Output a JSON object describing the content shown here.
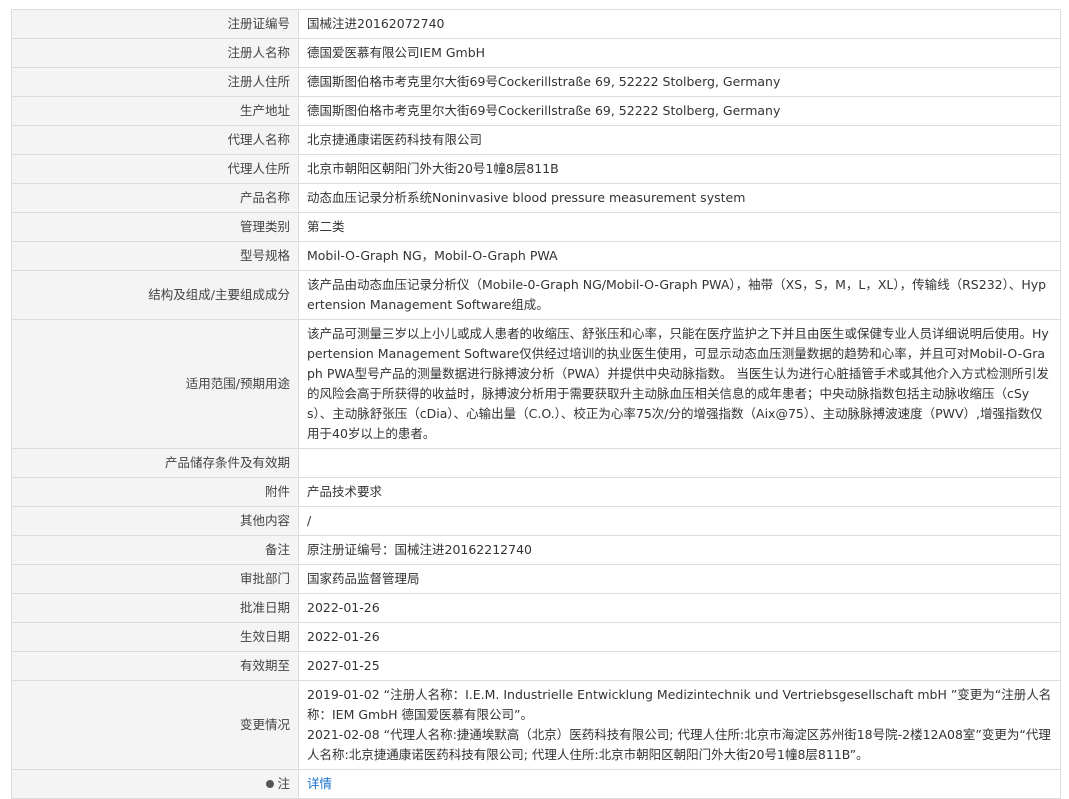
{
  "rows": [
    {
      "label": "注册证编号",
      "value": "国械注进20162072740"
    },
    {
      "label": "注册人名称",
      "value": "德国爱医慕有限公司IEM GmbH"
    },
    {
      "label": "注册人住所",
      "value": "德国斯图伯格市考克里尔大街69号Cockerillstraße 69, 52222 Stolberg, Germany"
    },
    {
      "label": "生产地址",
      "value": "德国斯图伯格市考克里尔大街69号Cockerillstraße 69, 52222 Stolberg, Germany"
    },
    {
      "label": "代理人名称",
      "value": "北京捷通康诺医药科技有限公司"
    },
    {
      "label": "代理人住所",
      "value": "北京市朝阳区朝阳门外大街20号1幢8层811B"
    },
    {
      "label": "产品名称",
      "value": "动态血压记录分析系统Noninvasive blood pressure measurement system"
    },
    {
      "label": "管理类别",
      "value": "第二类"
    },
    {
      "label": "型号规格",
      "value": "Mobil-O-Graph NG，Mobil-O-Graph PWA"
    },
    {
      "label": "结构及组成/主要组成成分",
      "value": "该产品由动态血压记录分析仪（Mobile-0-Graph NG/Mobil-O-Graph PWA），袖带（XS，S，M，L，XL），传输线（RS232）、Hypertension Management Software组成。"
    },
    {
      "label": "适用范围/预期用途",
      "value": "该产品可测量三岁以上小儿或成人患者的收缩压、舒张压和心率，只能在医疗监护之下并且由医生或保健专业人员详细说明后使用。Hypertension Management Software仅供经过培训的执业医生使用，可显示动态血压测量数据的趋势和心率，并且可对Mobil-O-Graph PWA型号产品的测量数据进行脉搏波分析（PWA）并提供中央动脉指数。 当医生认为进行心脏插管手术或其他介入方式检测所引发的风险会高于所获得的收益时，脉搏波分析用于需要获取升主动脉血压相关信息的成年患者；中央动脉指数包括主动脉收缩压（cSys）、主动脉舒张压（cDia）、心输出量（C.O.）、校正为心率75次/分的增强指数（Aix@75）、主动脉脉搏波速度（PWV）,增强指数仅用于40岁以上的患者。"
    },
    {
      "label": "产品储存条件及有效期",
      "value": ""
    },
    {
      "label": "附件",
      "value": "产品技术要求"
    },
    {
      "label": "其他内容",
      "value": "/"
    },
    {
      "label": "备注",
      "value": "原注册证编号：国械注进20162212740"
    },
    {
      "label": "审批部门",
      "value": "国家药品监督管理局"
    },
    {
      "label": "批准日期",
      "value": "2022-01-26"
    },
    {
      "label": "生效日期",
      "value": "2022-01-26"
    },
    {
      "label": "有效期至",
      "value": "2027-01-25"
    }
  ],
  "changes": {
    "label": "变更情况",
    "lines": [
      "2019-01-02 “注册人名称：I.E.M. Industrielle Entwicklung Medizintechnik und Vertriebsgesellschaft mbH ”变更为“注册人名称：IEM GmbH 德国爱医慕有限公司”。",
      "2021-02-08 “代理人名称:捷通埃默高（北京）医药科技有限公司; 代理人住所:北京市海淀区苏州街18号院-2楼12A08室”变更为“代理人名称:北京捷通康诺医药科技有限公司; 代理人住所:北京市朝阳区朝阳门外大街20号1幢8层811B”。"
    ]
  },
  "note": {
    "label": "注",
    "link": "详情",
    "icon": "dot-icon"
  }
}
